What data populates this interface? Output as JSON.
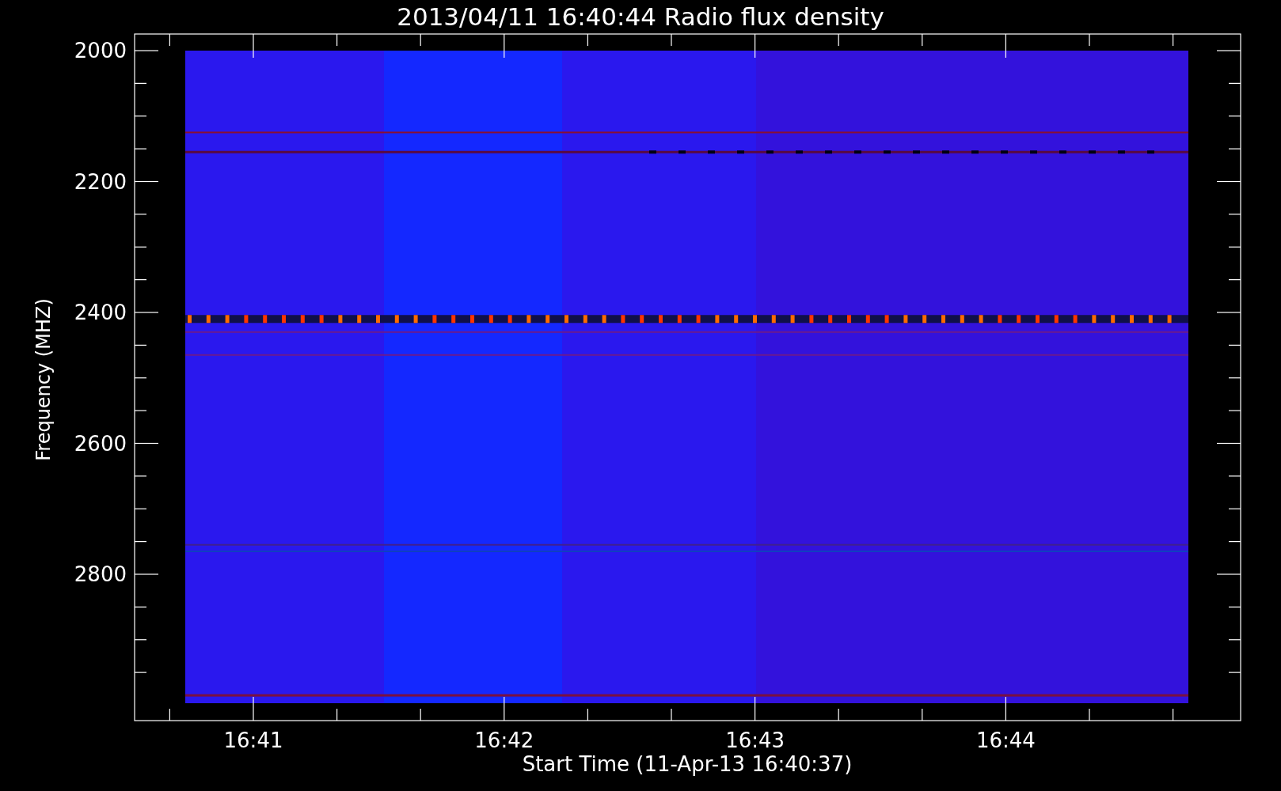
{
  "plot": {
    "title": "2013/04/11 16:40:44 Radio flux density",
    "y_axis": {
      "label": "Frequency (MHZ)",
      "ticks": [
        "2000",
        "2200",
        "2400",
        "2600",
        "2800"
      ]
    },
    "x_axis": {
      "label": "Start Time (11-Apr-13 16:40:37)",
      "ticks": [
        "16:41",
        "16:42",
        "16:43",
        "16:44"
      ]
    }
  }
}
